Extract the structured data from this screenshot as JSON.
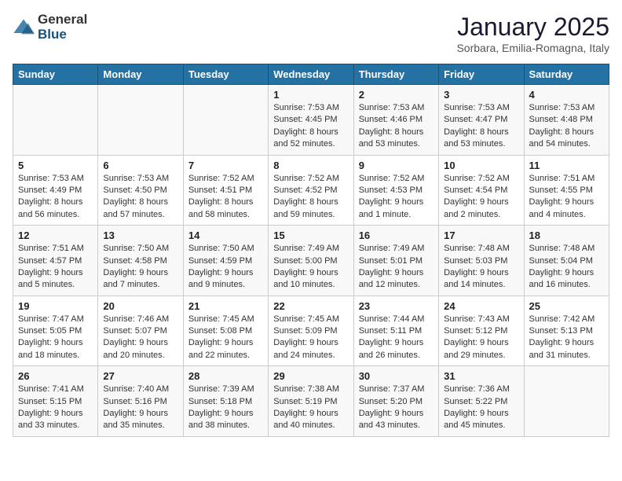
{
  "header": {
    "logo_general": "General",
    "logo_blue": "Blue",
    "month_title": "January 2025",
    "subtitle": "Sorbara, Emilia-Romagna, Italy"
  },
  "days_of_week": [
    "Sunday",
    "Monday",
    "Tuesday",
    "Wednesday",
    "Thursday",
    "Friday",
    "Saturday"
  ],
  "weeks": [
    [
      {
        "day": "",
        "sunrise": "",
        "sunset": "",
        "daylight": ""
      },
      {
        "day": "",
        "sunrise": "",
        "sunset": "",
        "daylight": ""
      },
      {
        "day": "",
        "sunrise": "",
        "sunset": "",
        "daylight": ""
      },
      {
        "day": "1",
        "sunrise": "Sunrise: 7:53 AM",
        "sunset": "Sunset: 4:45 PM",
        "daylight": "Daylight: 8 hours and 52 minutes."
      },
      {
        "day": "2",
        "sunrise": "Sunrise: 7:53 AM",
        "sunset": "Sunset: 4:46 PM",
        "daylight": "Daylight: 8 hours and 53 minutes."
      },
      {
        "day": "3",
        "sunrise": "Sunrise: 7:53 AM",
        "sunset": "Sunset: 4:47 PM",
        "daylight": "Daylight: 8 hours and 53 minutes."
      },
      {
        "day": "4",
        "sunrise": "Sunrise: 7:53 AM",
        "sunset": "Sunset: 4:48 PM",
        "daylight": "Daylight: 8 hours and 54 minutes."
      }
    ],
    [
      {
        "day": "5",
        "sunrise": "Sunrise: 7:53 AM",
        "sunset": "Sunset: 4:49 PM",
        "daylight": "Daylight: 8 hours and 56 minutes."
      },
      {
        "day": "6",
        "sunrise": "Sunrise: 7:53 AM",
        "sunset": "Sunset: 4:50 PM",
        "daylight": "Daylight: 8 hours and 57 minutes."
      },
      {
        "day": "7",
        "sunrise": "Sunrise: 7:52 AM",
        "sunset": "Sunset: 4:51 PM",
        "daylight": "Daylight: 8 hours and 58 minutes."
      },
      {
        "day": "8",
        "sunrise": "Sunrise: 7:52 AM",
        "sunset": "Sunset: 4:52 PM",
        "daylight": "Daylight: 8 hours and 59 minutes."
      },
      {
        "day": "9",
        "sunrise": "Sunrise: 7:52 AM",
        "sunset": "Sunset: 4:53 PM",
        "daylight": "Daylight: 9 hours and 1 minute."
      },
      {
        "day": "10",
        "sunrise": "Sunrise: 7:52 AM",
        "sunset": "Sunset: 4:54 PM",
        "daylight": "Daylight: 9 hours and 2 minutes."
      },
      {
        "day": "11",
        "sunrise": "Sunrise: 7:51 AM",
        "sunset": "Sunset: 4:55 PM",
        "daylight": "Daylight: 9 hours and 4 minutes."
      }
    ],
    [
      {
        "day": "12",
        "sunrise": "Sunrise: 7:51 AM",
        "sunset": "Sunset: 4:57 PM",
        "daylight": "Daylight: 9 hours and 5 minutes."
      },
      {
        "day": "13",
        "sunrise": "Sunrise: 7:50 AM",
        "sunset": "Sunset: 4:58 PM",
        "daylight": "Daylight: 9 hours and 7 minutes."
      },
      {
        "day": "14",
        "sunrise": "Sunrise: 7:50 AM",
        "sunset": "Sunset: 4:59 PM",
        "daylight": "Daylight: 9 hours and 9 minutes."
      },
      {
        "day": "15",
        "sunrise": "Sunrise: 7:49 AM",
        "sunset": "Sunset: 5:00 PM",
        "daylight": "Daylight: 9 hours and 10 minutes."
      },
      {
        "day": "16",
        "sunrise": "Sunrise: 7:49 AM",
        "sunset": "Sunset: 5:01 PM",
        "daylight": "Daylight: 9 hours and 12 minutes."
      },
      {
        "day": "17",
        "sunrise": "Sunrise: 7:48 AM",
        "sunset": "Sunset: 5:03 PM",
        "daylight": "Daylight: 9 hours and 14 minutes."
      },
      {
        "day": "18",
        "sunrise": "Sunrise: 7:48 AM",
        "sunset": "Sunset: 5:04 PM",
        "daylight": "Daylight: 9 hours and 16 minutes."
      }
    ],
    [
      {
        "day": "19",
        "sunrise": "Sunrise: 7:47 AM",
        "sunset": "Sunset: 5:05 PM",
        "daylight": "Daylight: 9 hours and 18 minutes."
      },
      {
        "day": "20",
        "sunrise": "Sunrise: 7:46 AM",
        "sunset": "Sunset: 5:07 PM",
        "daylight": "Daylight: 9 hours and 20 minutes."
      },
      {
        "day": "21",
        "sunrise": "Sunrise: 7:45 AM",
        "sunset": "Sunset: 5:08 PM",
        "daylight": "Daylight: 9 hours and 22 minutes."
      },
      {
        "day": "22",
        "sunrise": "Sunrise: 7:45 AM",
        "sunset": "Sunset: 5:09 PM",
        "daylight": "Daylight: 9 hours and 24 minutes."
      },
      {
        "day": "23",
        "sunrise": "Sunrise: 7:44 AM",
        "sunset": "Sunset: 5:11 PM",
        "daylight": "Daylight: 9 hours and 26 minutes."
      },
      {
        "day": "24",
        "sunrise": "Sunrise: 7:43 AM",
        "sunset": "Sunset: 5:12 PM",
        "daylight": "Daylight: 9 hours and 29 minutes."
      },
      {
        "day": "25",
        "sunrise": "Sunrise: 7:42 AM",
        "sunset": "Sunset: 5:13 PM",
        "daylight": "Daylight: 9 hours and 31 minutes."
      }
    ],
    [
      {
        "day": "26",
        "sunrise": "Sunrise: 7:41 AM",
        "sunset": "Sunset: 5:15 PM",
        "daylight": "Daylight: 9 hours and 33 minutes."
      },
      {
        "day": "27",
        "sunrise": "Sunrise: 7:40 AM",
        "sunset": "Sunset: 5:16 PM",
        "daylight": "Daylight: 9 hours and 35 minutes."
      },
      {
        "day": "28",
        "sunrise": "Sunrise: 7:39 AM",
        "sunset": "Sunset: 5:18 PM",
        "daylight": "Daylight: 9 hours and 38 minutes."
      },
      {
        "day": "29",
        "sunrise": "Sunrise: 7:38 AM",
        "sunset": "Sunset: 5:19 PM",
        "daylight": "Daylight: 9 hours and 40 minutes."
      },
      {
        "day": "30",
        "sunrise": "Sunrise: 7:37 AM",
        "sunset": "Sunset: 5:20 PM",
        "daylight": "Daylight: 9 hours and 43 minutes."
      },
      {
        "day": "31",
        "sunrise": "Sunrise: 7:36 AM",
        "sunset": "Sunset: 5:22 PM",
        "daylight": "Daylight: 9 hours and 45 minutes."
      },
      {
        "day": "",
        "sunrise": "",
        "sunset": "",
        "daylight": ""
      }
    ]
  ]
}
